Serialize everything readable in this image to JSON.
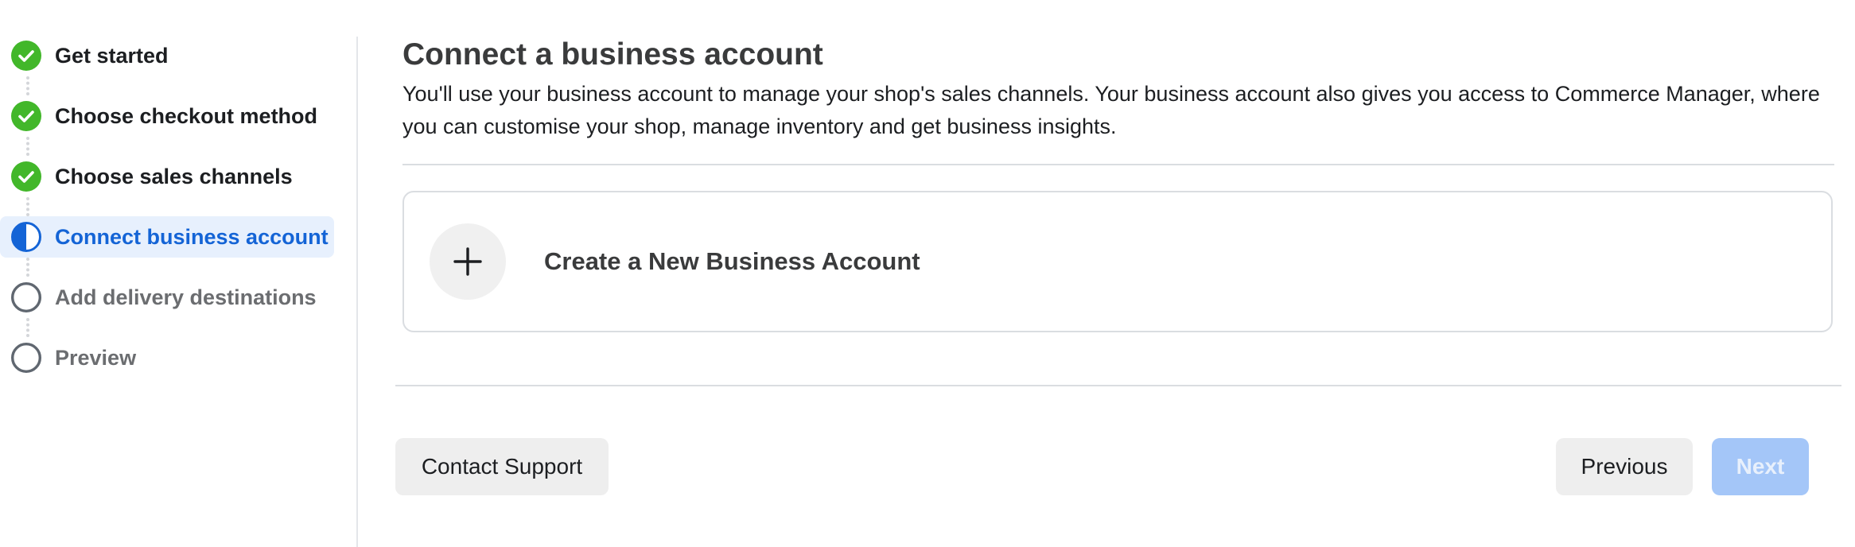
{
  "steps": [
    {
      "label": "Get started",
      "state": "done",
      "icon": "checkmark-circle-icon"
    },
    {
      "label": "Choose checkout method",
      "state": "done",
      "icon": "checkmark-circle-icon"
    },
    {
      "label": "Choose sales channels",
      "state": "done",
      "icon": "checkmark-circle-icon"
    },
    {
      "label": "Connect business account",
      "state": "current",
      "icon": "half-filled-circle-icon"
    },
    {
      "label": "Add delivery destinations",
      "state": "pending",
      "icon": "empty-circle-icon"
    },
    {
      "label": "Preview",
      "state": "pending",
      "icon": "empty-circle-icon"
    }
  ],
  "main": {
    "title": "Connect a business account",
    "description": "You'll use your business account to manage your shop's sales channels. Your business account also gives you access to Commerce Manager, where you can customise your shop, manage inventory and get business insights.",
    "create_card": {
      "label": "Create a New Business Account",
      "icon": "plus-icon"
    }
  },
  "footer": {
    "contact_support": "Contact Support",
    "previous": "Previous",
    "next": "Next"
  },
  "colors": {
    "done_green": "#42b72a",
    "current_blue": "#1464d6",
    "current_bg": "#e7f0fd",
    "pending_gray": "#6b6d70",
    "next_disabled": "#a4c6f8"
  }
}
